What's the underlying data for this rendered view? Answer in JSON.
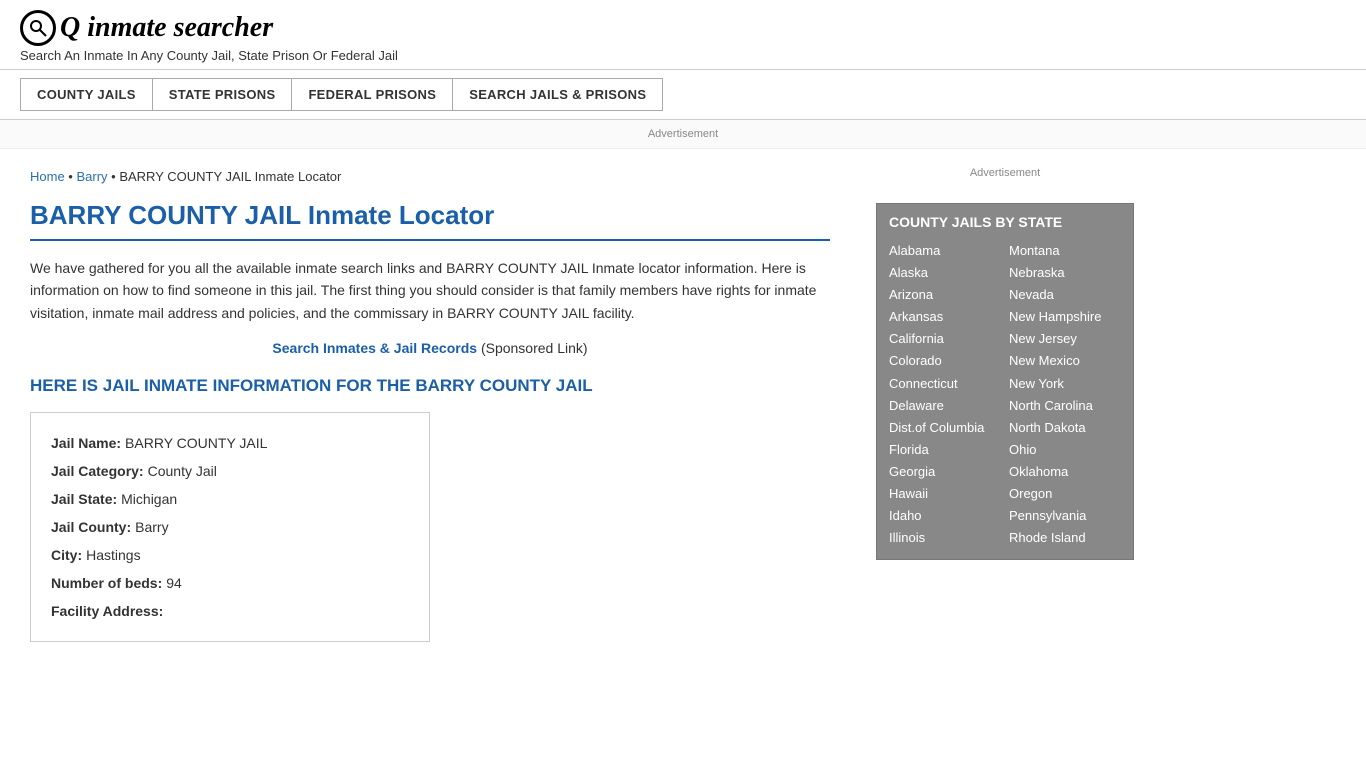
{
  "header": {
    "logo_icon": "🔍",
    "logo_text": "inmate searcher",
    "tagline": "Search An Inmate In Any County Jail, State Prison Or Federal Jail"
  },
  "nav": {
    "buttons": [
      {
        "id": "county-jails",
        "label": "COUNTY JAILS"
      },
      {
        "id": "state-prisons",
        "label": "STATE PRISONS"
      },
      {
        "id": "federal-prisons",
        "label": "FEDERAL PRISONS"
      },
      {
        "id": "search-jails",
        "label": "SEARCH JAILS & PRISONS"
      }
    ]
  },
  "ad_bar": {
    "label": "Advertisement"
  },
  "breadcrumb": {
    "home_label": "Home",
    "separator1": " • ",
    "barry_label": "Barry",
    "separator2": " • ",
    "current": "BARRY COUNTY JAIL Inmate Locator"
  },
  "page_title": "BARRY COUNTY JAIL Inmate Locator",
  "intro_text": "We have gathered for you all the available inmate search links and BARRY COUNTY JAIL Inmate locator information. Here is information on how to find someone in this jail. The first thing you should consider is that family members have rights for inmate visitation, inmate mail address and policies, and the commissary in BARRY COUNTY JAIL facility.",
  "sponsored": {
    "link_text": "Search Inmates & Jail Records",
    "label": "(Sponsored Link)"
  },
  "section_header": "HERE IS JAIL INMATE INFORMATION FOR THE BARRY COUNTY JAIL",
  "jail_info": {
    "name_label": "Jail Name:",
    "name_value": "BARRY COUNTY JAIL",
    "category_label": "Jail Category:",
    "category_value": "County Jail",
    "state_label": "Jail State:",
    "state_value": "Michigan",
    "county_label": "Jail County:",
    "county_value": "Barry",
    "city_label": "City:",
    "city_value": "Hastings",
    "beds_label": "Number of beds:",
    "beds_value": "94",
    "address_label": "Facility Address:"
  },
  "sidebar": {
    "ad_label": "Advertisement",
    "county_jails_title": "COUNTY JAILS BY STATE",
    "states_col1": [
      "Alabama",
      "Alaska",
      "Arizona",
      "Arkansas",
      "California",
      "Colorado",
      "Connecticut",
      "Delaware",
      "Dist.of Columbia",
      "Florida",
      "Georgia",
      "Hawaii",
      "Idaho",
      "Illinois"
    ],
    "states_col2": [
      "Montana",
      "Nebraska",
      "Nevada",
      "New Hampshire",
      "New Jersey",
      "New Mexico",
      "New York",
      "North Carolina",
      "North Dakota",
      "Ohio",
      "Oklahoma",
      "Oregon",
      "Pennsylvania",
      "Rhode Island"
    ]
  }
}
